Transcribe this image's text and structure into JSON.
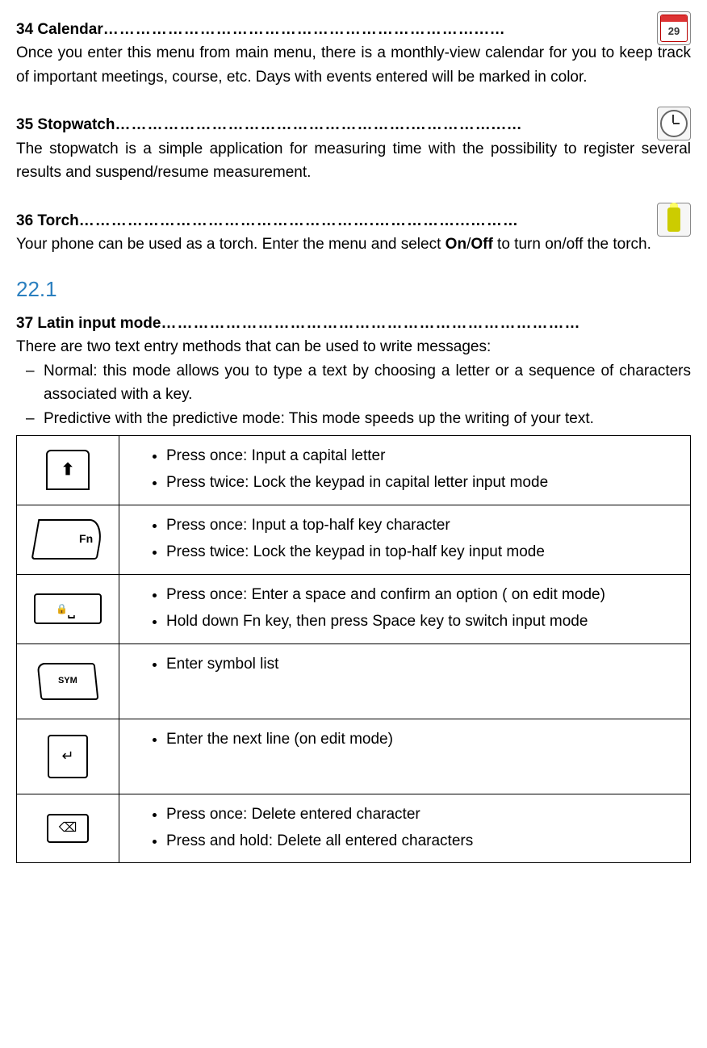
{
  "sections": {
    "calendar": {
      "heading": "34 Calendar",
      "dots": "……………………………………………………………...…",
      "body": "Once you enter this menu from main menu, there is a monthly-view calendar for you to keep track of important meetings, course, etc. Days with events entered will be marked in color.",
      "iconNum": "29"
    },
    "stopwatch": {
      "heading": "35 Stopwatch",
      "dots": "……………………………………………….……………...…",
      "body": "The stopwatch is a simple application for measuring time with the possibility to register several results and suspend/resume measurement."
    },
    "torch": {
      "heading": "36 Torch",
      "dots": "……………………………………………….……………...………",
      "body_pre": "Your phone can be used as a torch. Enter the menu and select ",
      "body_bold_on": "On",
      "body_slash": "/",
      "body_bold_off": "Off",
      "body_post": " to turn on/off the torch."
    },
    "latin": {
      "chapter": "22.1",
      "heading": "37 Latin input mode",
      "dots": "……………………………………………………………………",
      "intro": "There are two text entry methods that can be used to write messages:",
      "item1": "Normal: this mode allows you to type a text by choosing a letter or a sequence of characters associated with a key.",
      "item2": "Predictive with the predictive mode: This mode speeds up the writing of your text."
    }
  },
  "table": [
    {
      "keyLabel": "shift",
      "bullets": [
        "Press once: Input a capital letter",
        "Press twice: Lock the keypad in capital letter input mode"
      ]
    },
    {
      "keyLabel": "Fn",
      "bullets": [
        "Press once: Input a top-half key character",
        "Press twice: Lock the keypad in top-half key input mode"
      ]
    },
    {
      "keyLabel": "space",
      "bullets": [
        "Press once: Enter a space and confirm an option ( on edit mode)",
        "Hold down Fn key, then press Space key to switch input mode"
      ]
    },
    {
      "keyLabel": "SYM",
      "bullets": [
        "Enter symbol list"
      ]
    },
    {
      "keyLabel": "enter",
      "bullets": [
        "Enter the next line (on edit mode)"
      ]
    },
    {
      "keyLabel": "delete",
      "bullets": [
        "Press once: Delete entered character",
        "Press and hold: Delete all entered characters"
      ]
    }
  ]
}
